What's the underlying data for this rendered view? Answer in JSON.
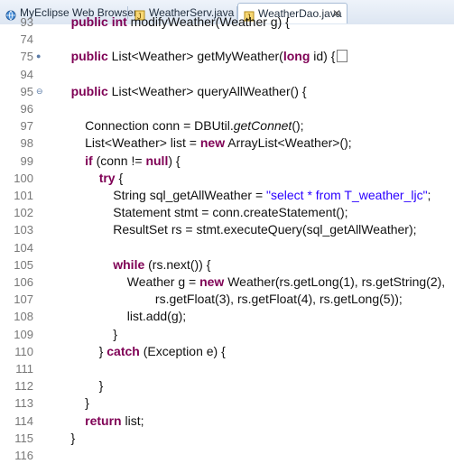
{
  "tabs": [
    {
      "label": "MyEclipse Web Browser",
      "icon": "globe-icon",
      "active": false
    },
    {
      "label": "WeatherServ.java",
      "icon": "java-file-icon",
      "active": false
    },
    {
      "label": "WeatherDao.java",
      "icon": "java-file-icon",
      "active": true,
      "close": "✕"
    }
  ],
  "editor": {
    "lines": [
      {
        "n": "93",
        "code": "    public int modifyWeather(Weather g) {"
      },
      {
        "n": "74",
        "code": ""
      },
      {
        "n": "75",
        "code": "    public List<Weather> getMyWeather(long id) {"
      },
      {
        "n": "94",
        "code": ""
      },
      {
        "n": "95",
        "code": "    public List<Weather> queryAllWeather() {"
      },
      {
        "n": "96",
        "code": ""
      },
      {
        "n": "97",
        "code": "        Connection conn = DBUtil.getConnet();"
      },
      {
        "n": "98",
        "code": "        List<Weather> list = new ArrayList<Weather>();"
      },
      {
        "n": "99",
        "code": "        if (conn != null) {"
      },
      {
        "n": "100",
        "code": "            try {"
      },
      {
        "n": "101",
        "code": "                String sql_getAllWeather = \"select * from T_weather_ljc\";"
      },
      {
        "n": "102",
        "code": "                Statement stmt = conn.createStatement();"
      },
      {
        "n": "103",
        "code": "                ResultSet rs = stmt.executeQuery(sql_getAllWeather);"
      },
      {
        "n": "104",
        "code": ""
      },
      {
        "n": "105",
        "code": "                while (rs.next()) {"
      },
      {
        "n": "106",
        "code": "                    Weather g = new Weather(rs.getLong(1), rs.getString(2),"
      },
      {
        "n": "107",
        "code": "                            rs.getFloat(3), rs.getFloat(4), rs.getLong(5));"
      },
      {
        "n": "108",
        "code": "                    list.add(g);"
      },
      {
        "n": "109",
        "code": "                }"
      },
      {
        "n": "110",
        "code": "            } catch (Exception e) {"
      },
      {
        "n": "111",
        "code": ""
      },
      {
        "n": "112",
        "code": "            }"
      },
      {
        "n": "113",
        "code": "        }"
      },
      {
        "n": "114",
        "code": "        return list;"
      },
      {
        "n": "115",
        "code": "    }"
      },
      {
        "n": "116",
        "code": ""
      }
    ]
  }
}
